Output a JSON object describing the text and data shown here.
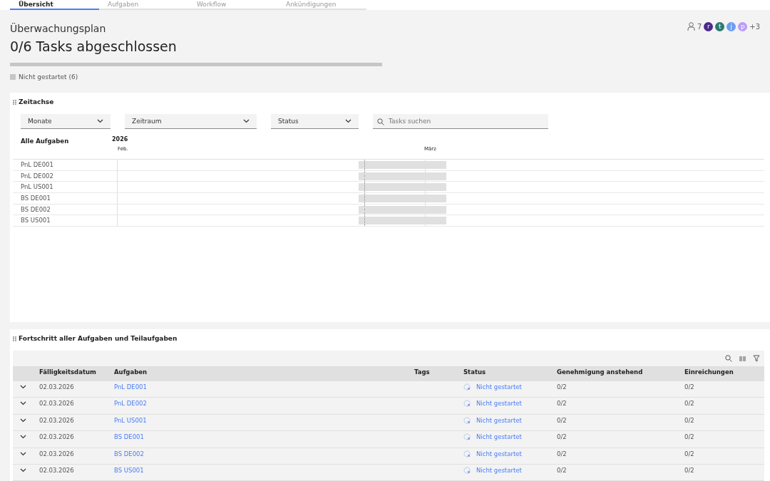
{
  "tabs": [
    {
      "label": "Übersicht",
      "selected": true
    },
    {
      "label": "Aufgaben",
      "selected": false
    },
    {
      "label": "Workflow",
      "selected": false
    },
    {
      "label": "Ankündigungen",
      "selected": false
    }
  ],
  "header": {
    "subtitle": "Überwachungsplan",
    "title": "0/6 Tasks abgeschlossen",
    "progress": {
      "level": 0
    },
    "legend": "Nicht gestartet (6)"
  },
  "members": {
    "count": "7",
    "avatars": [
      {
        "initial": "r",
        "color": "#4b2a8c"
      },
      {
        "initial": "t",
        "color": "#2b7a70"
      },
      {
        "initial": "j",
        "color": "#6c9cf2"
      },
      {
        "initial": "p",
        "color": "#b99cf6"
      }
    ],
    "more": "+3"
  },
  "timeline": {
    "title": "Zeitachse",
    "filters": [
      {
        "kind": "dropdown",
        "label": "Monate"
      },
      {
        "kind": "dropdown",
        "label": "Zeitraum"
      },
      {
        "kind": "dropdown",
        "label": "Status"
      },
      {
        "kind": "search",
        "placeholder": "Tasks suchen"
      }
    ],
    "label_header": "Alle Aufgaben",
    "year": "2026",
    "months": [
      "Feb.",
      "März"
    ],
    "rows": [
      "PnL DE001",
      "PnL DE002",
      "PnL US001",
      "BS DE001",
      "BS DE002",
      "BS US001"
    ]
  },
  "progress_table": {
    "title": "Fortschritt aller Aufgaben und Teilaufgaben",
    "columns": [
      "Fälligkeitsdatum",
      "Aufgaben",
      "Tags",
      "Status",
      "Genehmigung anstehend",
      "Einreichungen"
    ],
    "rows": [
      {
        "expanded": false,
        "due": "02.03.2026",
        "task": "PnL DE001",
        "status": "Nicht gestartet",
        "approval": "0/2",
        "submissions": "0/2"
      },
      {
        "expanded": false,
        "due": "02.03.2026",
        "task": "PnL DE002",
        "status": "Nicht gestartet",
        "approval": "0/2",
        "submissions": "0/2"
      },
      {
        "expanded": false,
        "due": "02.03.2026",
        "task": "PnL US001",
        "status": "Nicht gestartet",
        "approval": "0/2",
        "submissions": "0/2"
      },
      {
        "expanded": false,
        "due": "02.03.2026",
        "task": "BS DE001",
        "status": "Nicht gestartet",
        "approval": "0/2",
        "submissions": "0/2"
      },
      {
        "expanded": false,
        "due": "02.03.2026",
        "task": "BS DE002",
        "status": "Nicht gestartet",
        "approval": "0/2",
        "submissions": "0/2"
      },
      {
        "expanded": false,
        "due": "02.03.2026",
        "task": "BS US001",
        "status": "Nicht gestartet",
        "approval": "0/2",
        "submissions": "0/2"
      }
    ]
  }
}
